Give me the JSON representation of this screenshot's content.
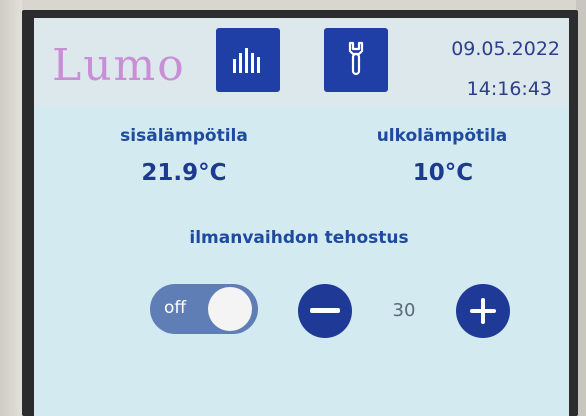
{
  "header": {
    "logo": "Lumo",
    "date": "09.05.2022",
    "time": "14:16:43",
    "stats_icon": "bar-chart-icon",
    "settings_icon": "wrench-icon"
  },
  "indoor": {
    "label": "sisälämpötila",
    "value": "21.9°C"
  },
  "outdoor": {
    "label": "ulkolämpötila",
    "value": "10°C"
  },
  "ventilation_boost": {
    "label": "ilmanvaihdon tehostus",
    "toggle_text": "off",
    "toggle_on": false,
    "value": "30"
  },
  "colors": {
    "screen_bg": "#d3eaf0",
    "button_blue": "#1f3a96",
    "text_blue": "#1e4aa0",
    "logo_pink": "#c98fd6",
    "toggle_off": "#5f7eb6"
  }
}
